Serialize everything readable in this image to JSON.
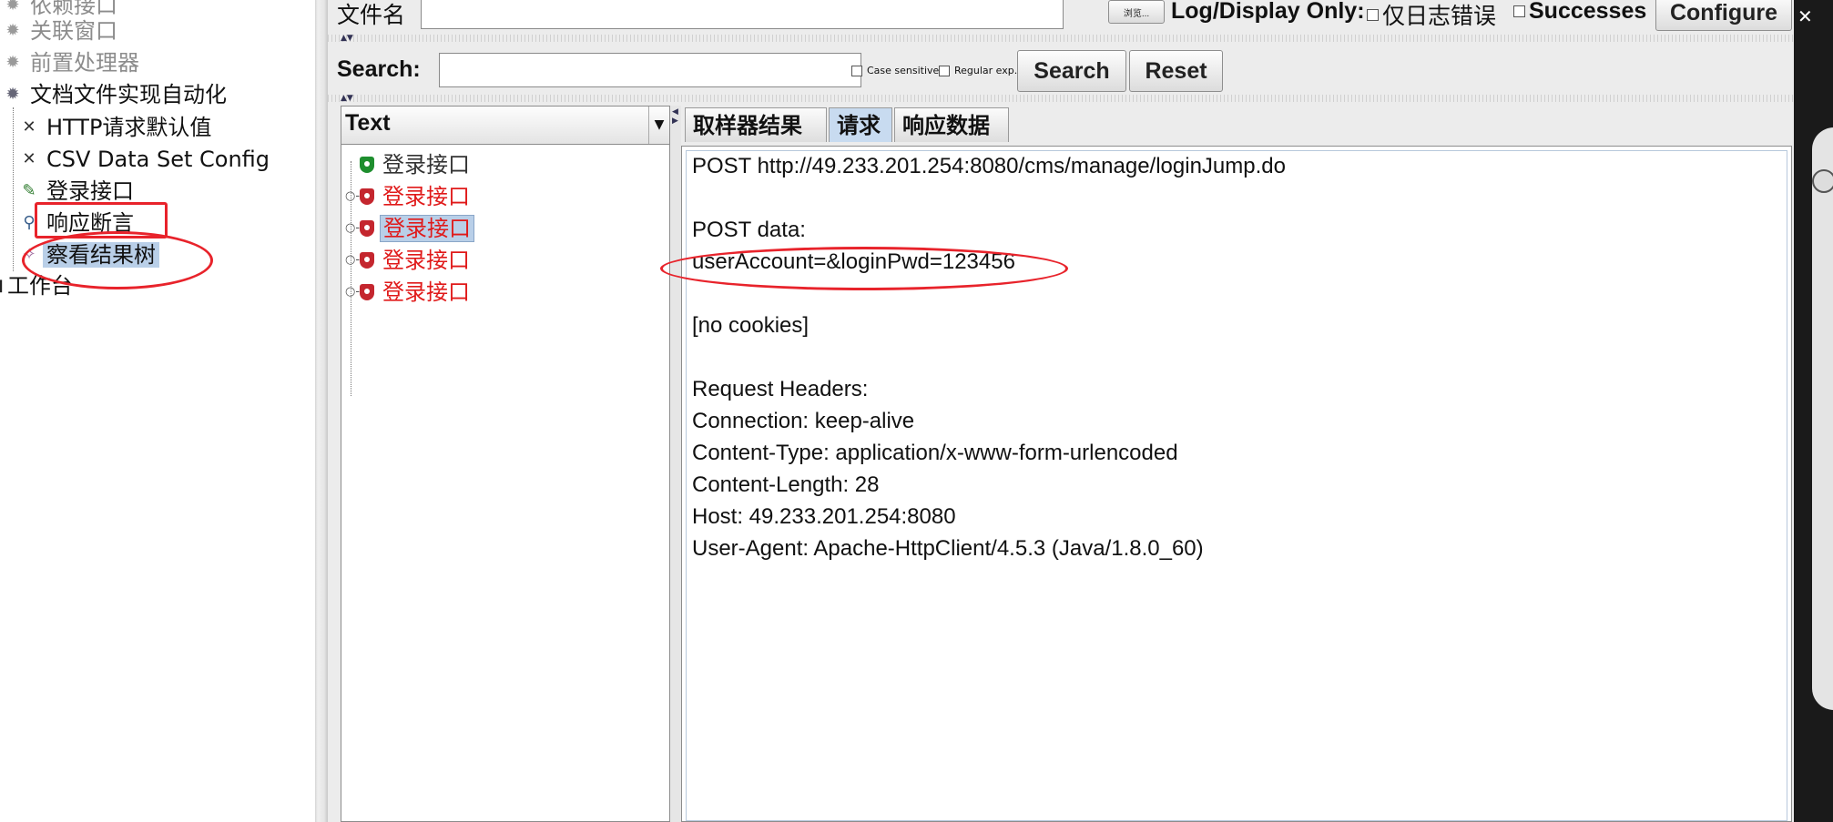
{
  "tree": {
    "items": [
      {
        "label": "依赖接口",
        "icon": "gear-icon"
      },
      {
        "label": "关联窗口",
        "icon": "gear-icon"
      },
      {
        "label": "前置处理器",
        "icon": "gear-icon"
      },
      {
        "label": "文档文件实现自动化",
        "icon": "gear-icon"
      },
      {
        "label": "HTTP请求默认值",
        "icon": "wrench-icon"
      },
      {
        "label": "CSV Data Set Config",
        "icon": "wrench-icon"
      },
      {
        "label": "登录接口",
        "icon": "pipette-icon"
      },
      {
        "label": "响应断言",
        "icon": "magnifier-icon"
      },
      {
        "label": "察看结果树",
        "icon": "tree-icon"
      },
      {
        "label": "工作台",
        "icon": "workbench-icon"
      }
    ]
  },
  "top": {
    "filename_label": "文件名",
    "browse_label": "浏览...",
    "log_display_label": "Log/Display Only:",
    "errors_label": "仅日志错误",
    "successes_label": "Successes",
    "configure_label": "Configure"
  },
  "search": {
    "label": "Search:",
    "case_label": "Case sensitive",
    "regex_label": "Regular exp.",
    "search_button": "Search",
    "reset_button": "Reset"
  },
  "results": {
    "renderer": "Text",
    "items": [
      {
        "label": "登录接口",
        "status": "ok"
      },
      {
        "label": "登录接口",
        "status": "error"
      },
      {
        "label": "登录接口",
        "status": "error"
      },
      {
        "label": "登录接口",
        "status": "error"
      },
      {
        "label": "登录接口",
        "status": "error"
      }
    ]
  },
  "tabs": [
    "取样器结果",
    "请求",
    "响应数据"
  ],
  "request": {
    "lines": [
      "POST http://49.233.201.254:8080/cms/manage/loginJump.do",
      "",
      "POST data:",
      "userAccount=&loginPwd=123456",
      "",
      "[no cookies]",
      "",
      "Request Headers:",
      "Connection: keep-alive",
      "Content-Type: application/x-www-form-urlencoded",
      "Content-Length: 28",
      "Host: 49.233.201.254:8080",
      "User-Agent: Apache-HttpClient/4.5.3 (Java/1.8.0_60)"
    ]
  },
  "colors": {
    "annotation_red": "#e8232b",
    "error_text": "#e01a1a",
    "selection": "#b9cfe8"
  }
}
